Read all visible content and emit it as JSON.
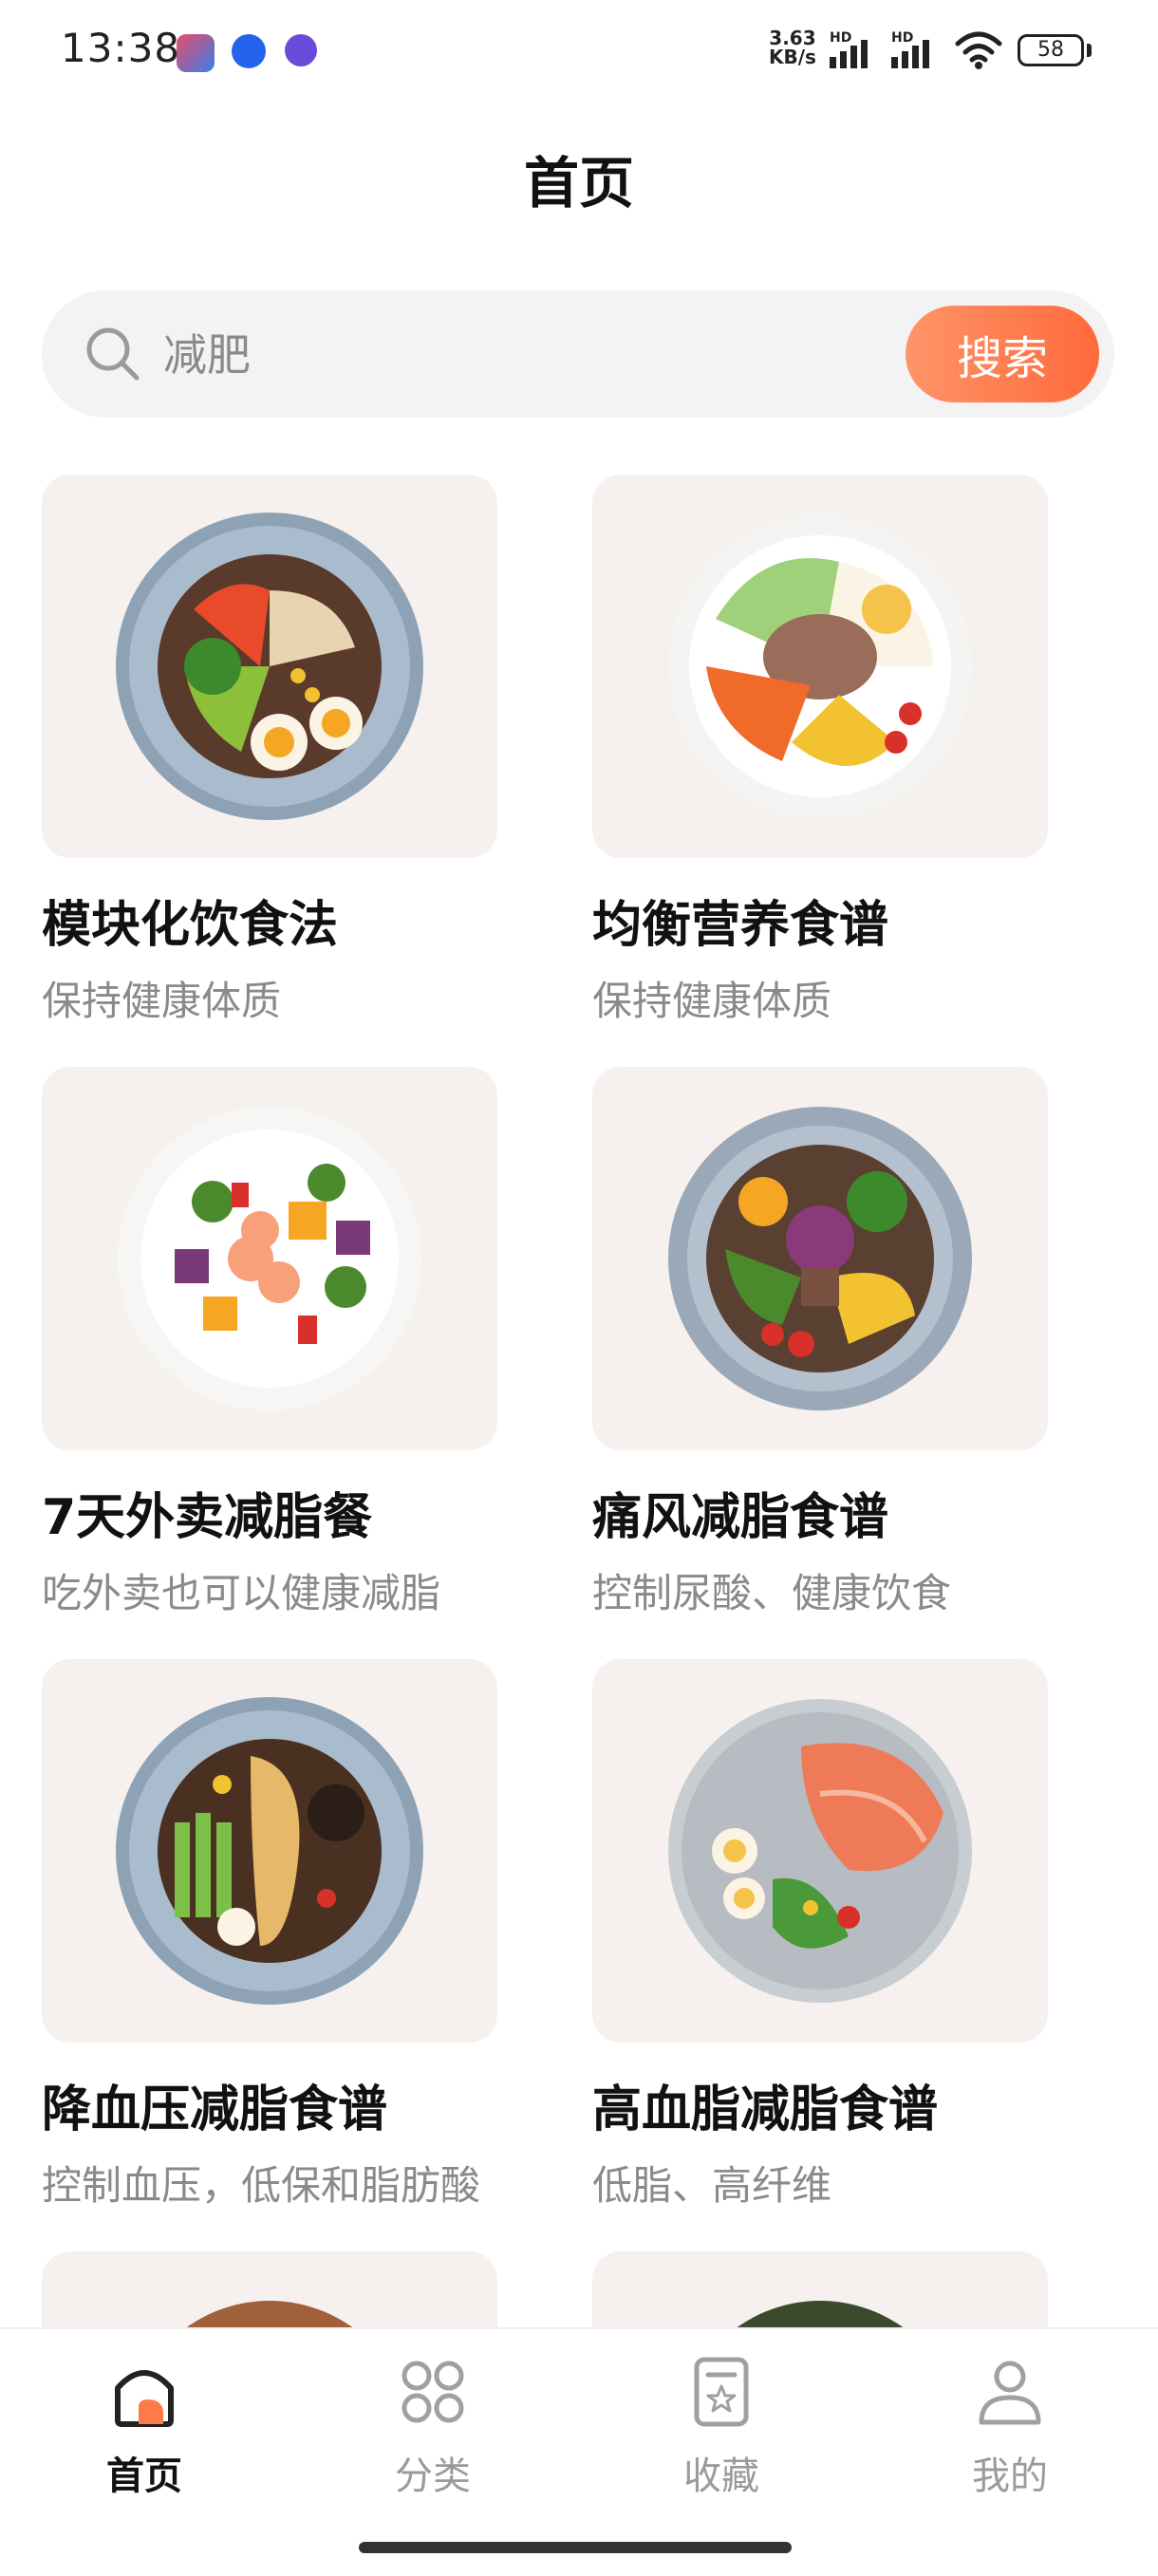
{
  "status_bar": {
    "time": "13:38",
    "net_speed_value": "3.63",
    "net_speed_unit": "KB/s",
    "signal_1_label": "HD",
    "signal_2_label": "HD",
    "battery": "58"
  },
  "header": {
    "title": "首页"
  },
  "search": {
    "value": "",
    "placeholder": "减肥",
    "button_label": "搜索"
  },
  "recipes": [
    {
      "title": "模块化饮食法",
      "subtitle": "保持健康体质",
      "icon": "chicken-bowl-image"
    },
    {
      "title": "均衡营养食谱",
      "subtitle": "保持健康体质",
      "icon": "tuna-salad-image"
    },
    {
      "title": "7天外卖减脂餐",
      "subtitle": "吃外卖也可以健康减脂",
      "icon": "shrimp-veggie-bowl-image"
    },
    {
      "title": "痛风减脂食谱",
      "subtitle": "控制尿酸、健康饮食",
      "icon": "beef-corn-bowl-image"
    },
    {
      "title": "降血压减脂食谱",
      "subtitle": "控制血压，低保和脂肪酸",
      "icon": "grilled-chicken-bowl-image"
    },
    {
      "title": "高血脂减脂食谱",
      "subtitle": "低脂、高纤维",
      "icon": "salmon-plate-image"
    },
    {
      "title": "",
      "subtitle": "",
      "icon": "partial-bowl-image"
    },
    {
      "title": "",
      "subtitle": "",
      "icon": "partial-salad-image"
    }
  ],
  "bottom_nav": [
    {
      "label": "首页",
      "icon": "home-icon",
      "active": true
    },
    {
      "label": "分类",
      "icon": "category-icon",
      "active": false
    },
    {
      "label": "收藏",
      "icon": "favorites-icon",
      "active": false
    },
    {
      "label": "我的",
      "icon": "profile-icon",
      "active": false
    }
  ],
  "colors": {
    "accent": "#ff7a4a",
    "card_bg": "#f6f1ee",
    "muted_text": "#8a8a8a"
  }
}
